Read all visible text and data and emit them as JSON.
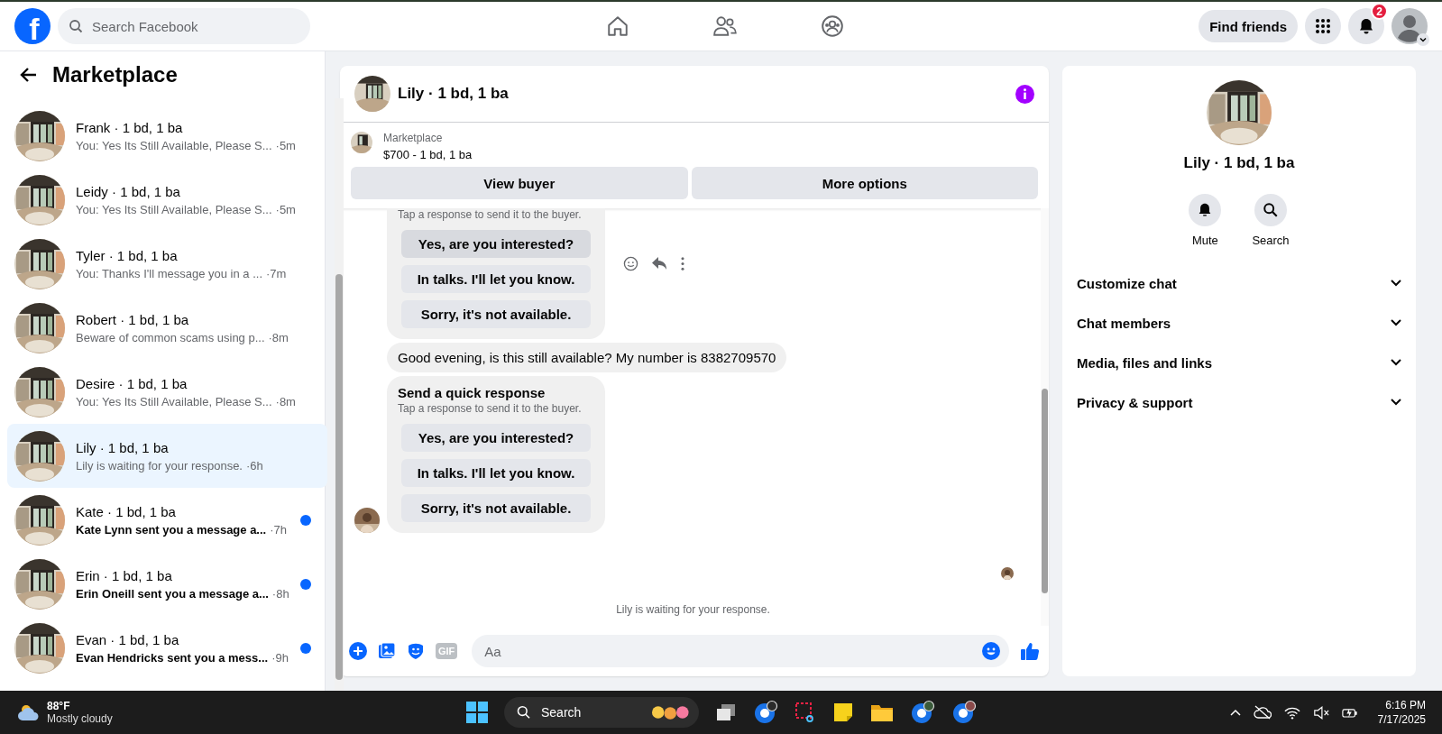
{
  "topbar": {
    "logo": "f",
    "search": {
      "placeholder": "Search Facebook"
    },
    "find_friends": "Find friends",
    "notification_count": "2"
  },
  "sidebar": {
    "title": "Marketplace",
    "conversations": [
      {
        "name": "Frank · 1 bd, 1 ba",
        "preview": "You: Yes Its Still Available, Please S...",
        "time": "·5m",
        "unread": false,
        "selected": false
      },
      {
        "name": "Leidy · 1 bd, 1 ba",
        "preview": "You: Yes Its Still Available, Please S...",
        "time": "·5m",
        "unread": false,
        "selected": false
      },
      {
        "name": "Tyler · 1 bd, 1 ba",
        "preview": "You: Thanks I'll message you in a ...",
        "time": "·7m",
        "unread": false,
        "selected": false
      },
      {
        "name": "Robert · 1 bd, 1 ba",
        "preview": "Beware of common scams using p...",
        "time": "·8m",
        "unread": false,
        "selected": false
      },
      {
        "name": "Desire · 1 bd, 1 ba",
        "preview": "You: Yes Its Still Available, Please S...",
        "time": "·8m",
        "unread": false,
        "selected": false
      },
      {
        "name": "Lily · 1 bd, 1 ba",
        "preview": "Lily is waiting for your response.",
        "time": "·6h",
        "unread": false,
        "selected": true
      },
      {
        "name": "Kate · 1 bd, 1 ba",
        "preview": "Kate Lynn sent you a message a...",
        "time": "·7h",
        "unread": true,
        "selected": false
      },
      {
        "name": "Erin · 1 bd, 1 ba",
        "preview": "Erin Oneill sent you a message a...",
        "time": "·8h",
        "unread": true,
        "selected": false
      },
      {
        "name": "Evan · 1 bd, 1 ba",
        "preview": "Evan Hendricks sent you a mess...",
        "time": "·9h",
        "unread": true,
        "selected": false
      }
    ]
  },
  "chat": {
    "title": "Lily · 1 bd, 1 ba",
    "listing": {
      "source": "Marketplace",
      "summary": "$700 - 1 bd, 1 ba"
    },
    "buttons": [
      "View buyer",
      "More options"
    ],
    "messages": [
      {
        "kind": "quick_responses",
        "show_actions": true,
        "subtitle": "Tap a response to send it to the buyer.",
        "options": [
          {
            "label": "Yes, are you interested?",
            "highlighted": true
          },
          {
            "label": "In talks. I'll let you know.",
            "highlighted": false
          },
          {
            "label": "Sorry, it's not available.",
            "highlighted": false
          }
        ]
      },
      {
        "kind": "text",
        "show_actions": false,
        "text": "Good evening, is this still available? My number is 8382709570"
      },
      {
        "kind": "quick_responses",
        "show_actions": false,
        "title": "Send a quick response",
        "subtitle": "Tap a response to send it to the buyer.",
        "options": [
          {
            "label": "Yes, are you interested?",
            "highlighted": false
          },
          {
            "label": "In talks. I'll let you know.",
            "highlighted": false
          },
          {
            "label": "Sorry, it's not available.",
            "highlighted": false
          }
        ]
      }
    ],
    "status": "Lily is waiting for your response.",
    "composer": {
      "gif": "GIF",
      "placeholder": "Aa"
    }
  },
  "details": {
    "title": "Lily · 1 bd, 1 ba",
    "actions": [
      {
        "kind": "mute",
        "label": "Mute"
      },
      {
        "kind": "search",
        "label": "Search"
      }
    ],
    "sections": [
      {
        "label": "Customize chat",
        "expanded": false
      },
      {
        "label": "Chat members",
        "expanded": false
      },
      {
        "label": "Media, files and links",
        "expanded": false
      },
      {
        "label": "Privacy & support",
        "expanded": false
      }
    ]
  },
  "taskbar": {
    "temperature": "88°F",
    "weather": "Mostly cloudy",
    "search": {
      "placeholder": "Search"
    },
    "time": "6:16 PM",
    "date": "7/17/2025"
  }
}
